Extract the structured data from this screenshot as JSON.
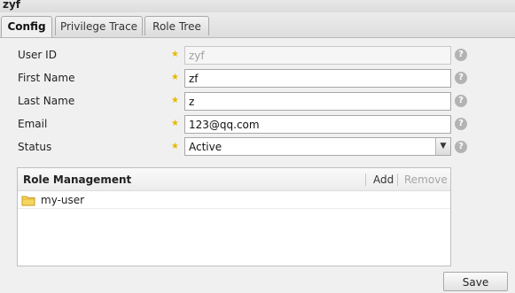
{
  "window": {
    "title": "zyf"
  },
  "tabs": [
    {
      "label": "Config",
      "active": true
    },
    {
      "label": "Privilege Trace",
      "active": false
    },
    {
      "label": "Role Tree",
      "active": false
    }
  ],
  "form": {
    "user_id": {
      "label": "User ID",
      "value": "zyf",
      "readonly": true
    },
    "first_name": {
      "label": "First Name",
      "value": "zf"
    },
    "last_name": {
      "label": "Last Name",
      "value": "z"
    },
    "email": {
      "label": "Email",
      "value": "123@qq.com"
    },
    "status": {
      "label": "Status",
      "value": "Active"
    },
    "required_marker": "★",
    "help_marker": "?"
  },
  "role_management": {
    "title": "Role Management",
    "add_label": "Add",
    "remove_label": "Remove",
    "roles": [
      {
        "name": "my-user",
        "icon": "folder-icon"
      }
    ]
  },
  "footer": {
    "save_label": "Save"
  },
  "colors": {
    "required_star": "#e6b800",
    "help_icon": "#b3b3b3",
    "disabled_text": "#a5a5a5"
  }
}
